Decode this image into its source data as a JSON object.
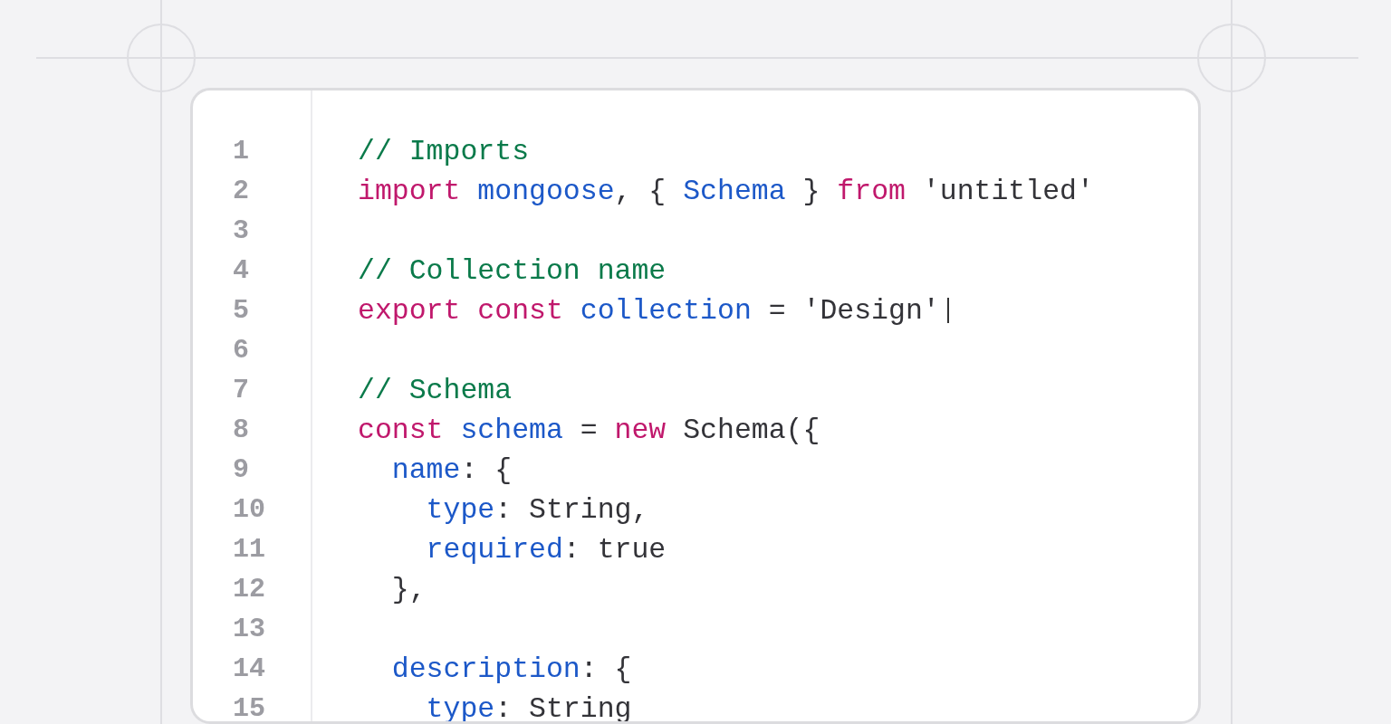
{
  "editor": {
    "lines": [
      {
        "number": "1",
        "tokens": [
          {
            "kind": "comment",
            "text": "// Imports"
          }
        ]
      },
      {
        "number": "2",
        "tokens": [
          {
            "kind": "keyword",
            "text": "import "
          },
          {
            "kind": "identifier",
            "text": "mongoose"
          },
          {
            "kind": "plain",
            "text": ", { "
          },
          {
            "kind": "identifier",
            "text": "Schema"
          },
          {
            "kind": "plain",
            "text": " } "
          },
          {
            "kind": "keyword",
            "text": "from"
          },
          {
            "kind": "plain",
            "text": " 'untitled'"
          }
        ]
      },
      {
        "number": "3"
      },
      {
        "number": "4",
        "tokens": [
          {
            "kind": "comment",
            "text": "// Collection name"
          }
        ]
      },
      {
        "number": "5",
        "caret": true,
        "tokens": [
          {
            "kind": "keyword",
            "text": "export const "
          },
          {
            "kind": "identifier",
            "text": "collection"
          },
          {
            "kind": "plain",
            "text": " = 'Design'"
          }
        ]
      },
      {
        "number": "6"
      },
      {
        "number": "7",
        "tokens": [
          {
            "kind": "comment",
            "text": "// Schema"
          }
        ]
      },
      {
        "number": "8",
        "tokens": [
          {
            "kind": "keyword",
            "text": "const "
          },
          {
            "kind": "identifier",
            "text": "schema"
          },
          {
            "kind": "plain",
            "text": " = "
          },
          {
            "kind": "keyword",
            "text": "new"
          },
          {
            "kind": "plain",
            "text": " Schema({"
          }
        ]
      },
      {
        "number": "9",
        "tokens": [
          {
            "kind": "identifier",
            "text": "  name"
          },
          {
            "kind": "plain",
            "text": ": {"
          }
        ]
      },
      {
        "number": "10",
        "tokens": [
          {
            "kind": "identifier",
            "text": "    type"
          },
          {
            "kind": "plain",
            "text": ": String,"
          }
        ]
      },
      {
        "number": "11",
        "tokens": [
          {
            "kind": "identifier",
            "text": "    required"
          },
          {
            "kind": "plain",
            "text": ": true"
          }
        ]
      },
      {
        "number": "12",
        "tokens": [
          {
            "kind": "plain",
            "text": "  },"
          }
        ]
      },
      {
        "number": "13"
      },
      {
        "number": "14",
        "tokens": [
          {
            "kind": "identifier",
            "text": "  description"
          },
          {
            "kind": "plain",
            "text": ": {"
          }
        ]
      },
      {
        "number": "15",
        "tokens": [
          {
            "kind": "identifier",
            "text": "    type"
          },
          {
            "kind": "plain",
            "text": ": String"
          }
        ]
      }
    ]
  }
}
